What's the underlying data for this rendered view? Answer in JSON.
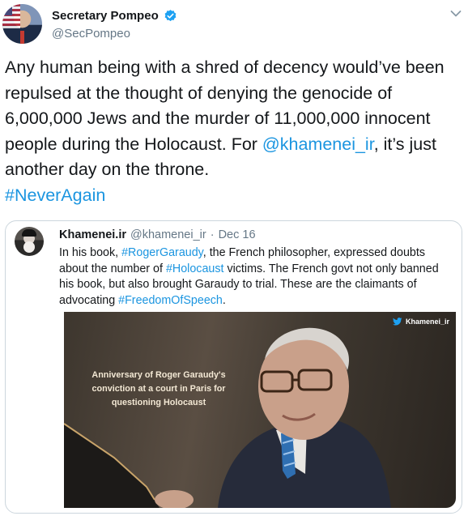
{
  "tweet": {
    "display_name": "Secretary Pompeo",
    "handle": "@SecPompeo",
    "text_part1": "Any human being with a shred of decency would’ve been repulsed at the thought of denying the genocide of 6,000,000 Jews and the murder of 11,000,000 innocent people during the Holocaust. For ",
    "mention": "@khamenei_ir",
    "text_part2": ", it’s just another day on the throne.",
    "hashtag": "#NeverAgain"
  },
  "quoted_tweet": {
    "display_name": "Khamenei.ir",
    "handle": "@khamenei_ir",
    "separator": "·",
    "date": "Dec 16",
    "text_1": "In his book, ",
    "tag_1": "#RogerGaraudy",
    "text_2": ", the French philosopher, expressed doubts about the number of ",
    "tag_2": "#Holocaust",
    "text_3": " victims. The French govt not only banned his book, but also brought Garaudy to trial. These are the claimants of advocating ",
    "tag_3": "#FreedomOfSpeech",
    "text_4": ".",
    "image": {
      "watermark": "Khamenei_ir",
      "caption": "Anniversary of Roger Garaudy's conviction at a court in Paris for questioning Holocaust"
    }
  },
  "colors": {
    "link": "#1b95e0",
    "verified_badge": "#1da1f2",
    "secondary_text": "#657786",
    "border": "#ccd6dd"
  },
  "icons": [
    "verified-badge-icon",
    "chevron-down-icon",
    "twitter-bird-icon"
  ]
}
